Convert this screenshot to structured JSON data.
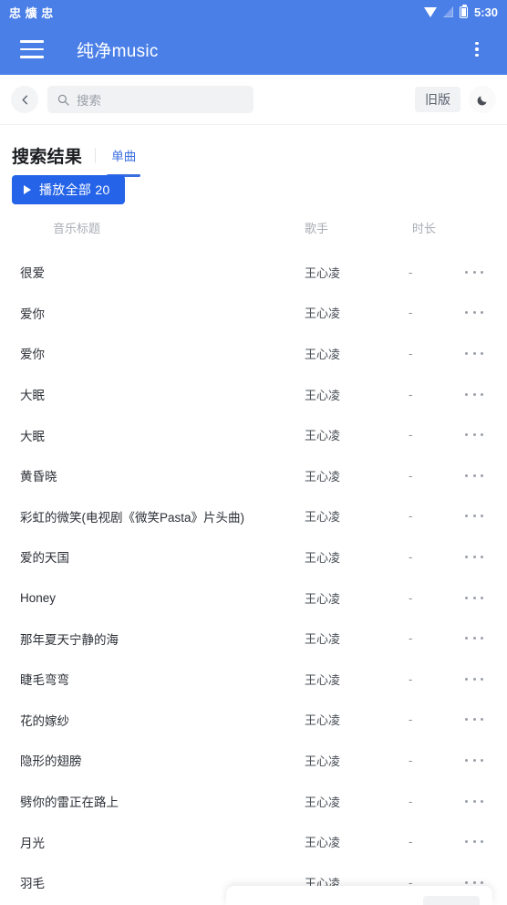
{
  "statusbar": {
    "left_glyphs": "忠 爌 忠",
    "time": "5:30",
    "icons": [
      "wifi-icon",
      "signal-icon",
      "battery-icon"
    ]
  },
  "appbar": {
    "menu_icon": "hamburger-menu-icon",
    "title": "纯净music",
    "overflow_icon": "kebab-menu-icon",
    "background": "#4a7fe8"
  },
  "searchbar": {
    "back_icon": "chevron-left-icon",
    "search_icon": "search-icon",
    "placeholder": "搜索",
    "value": "",
    "legacy_label": "旧版",
    "theme_icon": "moon-icon"
  },
  "results": {
    "title": "搜索结果",
    "tabs": [
      {
        "label": "单曲",
        "active": true
      }
    ],
    "play_all_label": "播放全部 20",
    "play_all_count": "20",
    "play_icon": "play-triangle-icon",
    "accent": "#2563e8"
  },
  "table": {
    "columns": {
      "title": "音乐标题",
      "artist": "歌手",
      "duration": "时长"
    },
    "more_icon": "more-horizontal-icon",
    "rows": [
      {
        "title": "很爱",
        "artist": "王心凌",
        "duration": "-"
      },
      {
        "title": "爱你",
        "artist": "王心凌",
        "duration": "-"
      },
      {
        "title": "爱你",
        "artist": "王心凌",
        "duration": "-"
      },
      {
        "title": "大眠",
        "artist": "王心凌",
        "duration": "-"
      },
      {
        "title": "大眠",
        "artist": "王心凌",
        "duration": "-"
      },
      {
        "title": "黄昏晓",
        "artist": "王心凌",
        "duration": "-"
      },
      {
        "title": "彩虹的微笑(电视剧《微笑Pasta》片头曲)",
        "artist": "王心凌",
        "duration": "-"
      },
      {
        "title": "爱的天国",
        "artist": "王心凌",
        "duration": "-"
      },
      {
        "title": "Honey",
        "artist": "王心凌",
        "duration": "-"
      },
      {
        "title": "那年夏天宁静的海",
        "artist": "王心凌",
        "duration": "-"
      },
      {
        "title": "睫毛弯弯",
        "artist": "王心凌",
        "duration": "-"
      },
      {
        "title": "花的嫁纱",
        "artist": "王心凌",
        "duration": "-"
      },
      {
        "title": "隐形的翅膀",
        "artist": "王心凌",
        "duration": "-"
      },
      {
        "title": "劈你的雷正在路上",
        "artist": "王心凌",
        "duration": "-"
      },
      {
        "title": "月光",
        "artist": "王心凌",
        "duration": "-"
      },
      {
        "title": "羽毛",
        "artist": "王心凌",
        "duration": "-"
      }
    ]
  }
}
